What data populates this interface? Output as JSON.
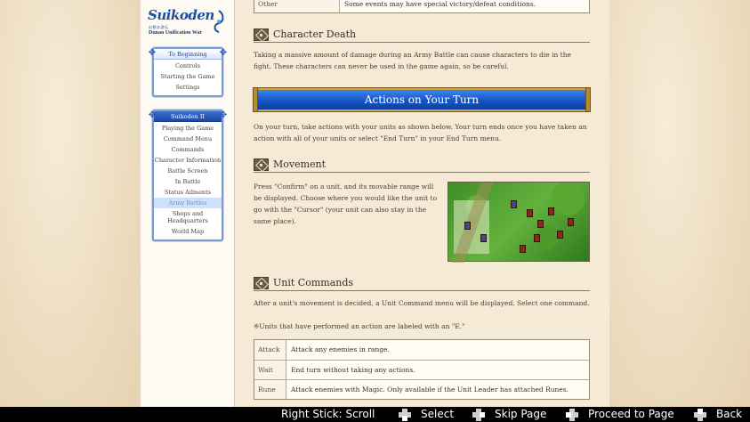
{
  "sidebar": {
    "logo": {
      "title": "Suikoden",
      "japanese": "幻想水滸伝",
      "subtitle": "Dunan Unification War"
    },
    "nav1": {
      "header": "To Beginning",
      "items": [
        "Controls",
        "Starting the Game",
        "Settings"
      ]
    },
    "nav2": {
      "header": "Suikoden II",
      "items": [
        "Playing the Game",
        "Command Menu",
        "Commands",
        "Character Information",
        "Battle Screen",
        "In Battle",
        "Status Ailments",
        "Army Battles",
        "Shops and Headquarters",
        "World Map"
      ],
      "active_index": 7
    }
  },
  "main": {
    "top_table": {
      "key": "Other",
      "value": "Some events may have special victory/defeat conditions."
    },
    "character_death": {
      "title": "Character Death",
      "text": "Taking a massive amount of damage during an Army Battle can cause characters to die in the fight. These characters can never be used in the game again, so be careful."
    },
    "banner": "Actions on Your Turn",
    "turn_intro": "On your turn, take actions with your units as shown below. Your turn ends once you have taken an action with all of your units or select \"End Turn\" in your End Turn menu.",
    "movement": {
      "title": "Movement",
      "text": "Press \"Confirm\" on a unit, and its movable range will be displayed. Choose where you would like the unit to go with the \"Cursor\" (your unit can also stay in the same place)."
    },
    "unit_commands": {
      "title": "Unit Commands",
      "text": "After a unit's movement is decided, a Unit Command menu will be displayed. Select one command.",
      "note": "※Units that have performed an action are labeled with an \"E.\"",
      "rows": [
        {
          "key": "Attack",
          "value": "Attack any enemies in range."
        },
        {
          "key": "Wait",
          "value": "End turn without taking any actions."
        },
        {
          "key": "Rune",
          "value": "Attack enemies with Magic. Only available if the Unit Leader has attached Runes."
        }
      ]
    }
  },
  "footer": {
    "scroll": "Right Stick: Scroll",
    "select": "Select",
    "skip": "Skip Page",
    "proceed": "Proceed to Page",
    "back": "Back"
  },
  "colors": {
    "accent_blue": "#1655c6",
    "banner_gold": "#c9a44a",
    "parchment": "#f5ead6"
  }
}
